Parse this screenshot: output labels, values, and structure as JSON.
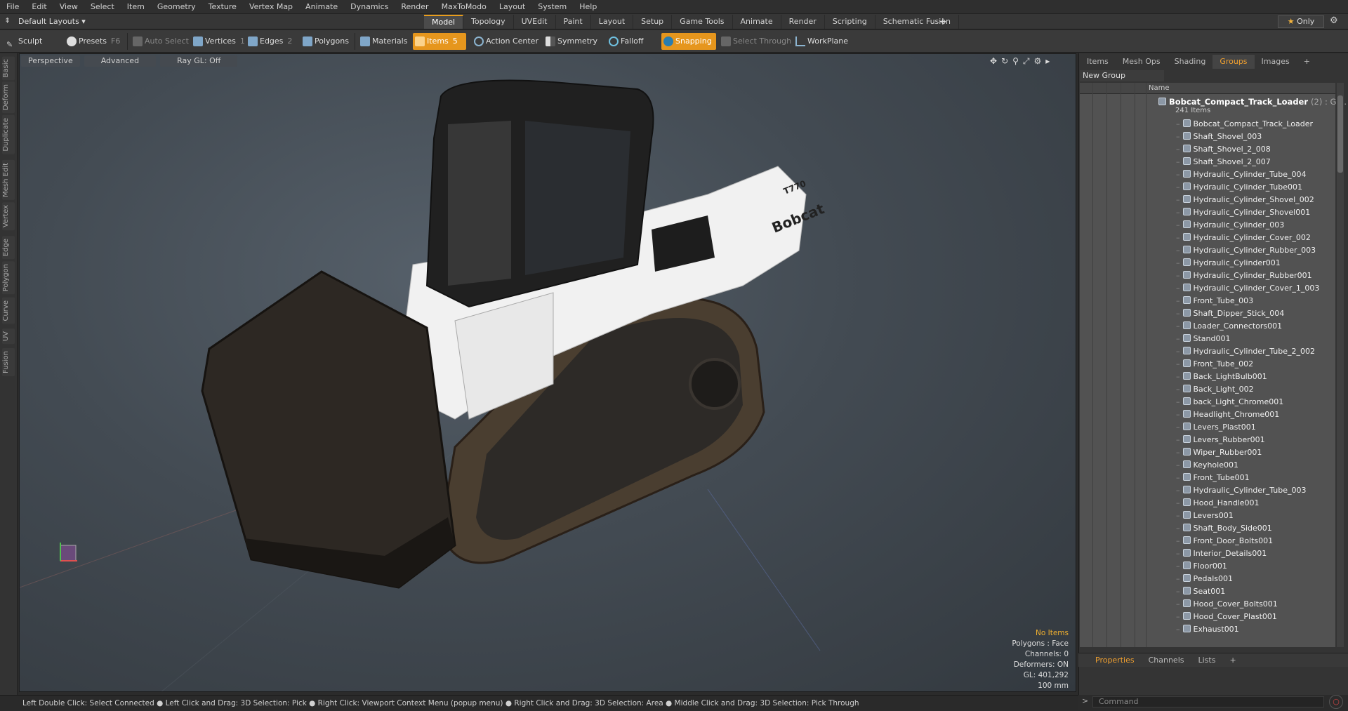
{
  "menu": [
    "File",
    "Edit",
    "View",
    "Select",
    "Item",
    "Geometry",
    "Texture",
    "Vertex Map",
    "Animate",
    "Dynamics",
    "Render",
    "MaxToModo",
    "Layout",
    "System",
    "Help"
  ],
  "layout_dropdown": "Default Layouts ▾",
  "mode_tabs": [
    "Model",
    "Topology",
    "UVEdit",
    "Paint",
    "Layout",
    "Setup",
    "Game Tools",
    "Animate",
    "Render",
    "Scripting",
    "Schematic Fusion"
  ],
  "mode_tab_plus": "+",
  "only_label": "Only",
  "toolbar": {
    "sculpt": "Sculpt",
    "presets": "Presets",
    "presets_key": "F6",
    "auto_select": "Auto Select",
    "vertices": "Vertices",
    "vertices_count": "1",
    "edges": "Edges",
    "edges_count": "2",
    "polygons": "Polygons",
    "materials": "Materials",
    "items": "Items",
    "items_count": "5",
    "action_center": "Action Center",
    "symmetry": "Symmetry",
    "falloff": "Falloff",
    "snapping": "Snapping",
    "select_through": "Select Through",
    "workplane": "WorkPlane"
  },
  "left_tabs": [
    "Basic",
    "Deform",
    "Duplicate",
    "Mesh Edit",
    "Vertex",
    "Edge",
    "Polygon",
    "Curve",
    "UV",
    "Fusion"
  ],
  "viewport": {
    "perspective": "Perspective",
    "advanced": "Advanced",
    "raygl": "Ray GL: Off",
    "stats": {
      "no_items": "No Items",
      "polygons": "Polygons : Face",
      "channels": "Channels: 0",
      "deformers": "Deformers: ON",
      "gl": "GL: 401,292",
      "scale": "100 mm"
    },
    "decal_logo": "Bobcat",
    "decal_model": "T770"
  },
  "status": "Left Double Click: Select Connected ● Left Click and Drag: 3D Selection: Pick ● Right Click: Viewport Context Menu (popup menu) ● Right Click and Drag: 3D Selection: Area ● Middle Click and Drag: 3D Selection: Pick Through",
  "right_tabs": [
    "Items",
    "Mesh Ops",
    "Shading",
    "Groups",
    "Images",
    "+"
  ],
  "right_active_tab": "Groups",
  "new_group": "New Group",
  "name_header": "Name",
  "group": {
    "name": "Bobcat_Compact_Track_Loader",
    "suffix": "(2) : Gr...",
    "count": "241 Items"
  },
  "items": [
    "Bobcat_Compact_Track_Loader",
    "Shaft_Shovel_003",
    "Shaft_Shovel_2_008",
    "Shaft_Shovel_2_007",
    "Hydraulic_Cylinder_Tube_004",
    "Hydraulic_Cylinder_Tube001",
    "Hydraulic_Cylinder_Shovel_002",
    "Hydraulic_Cylinder_Shovel001",
    "Hydraulic_Cylinder_003",
    "Hydraulic_Cylinder_Cover_002",
    "Hydraulic_Cylinder_Rubber_003",
    "Hydraulic_Cylinder001",
    "Hydraulic_Cylinder_Rubber001",
    "Hydraulic_Cylinder_Cover_1_003",
    "Front_Tube_003",
    "Shaft_Dipper_Stick_004",
    "Loader_Connectors001",
    "Stand001",
    "Hydraulic_Cylinder_Tube_2_002",
    "Front_Tube_002",
    "Back_LightBulb001",
    "Back_Light_002",
    "back_Light_Chrome001",
    "Headlight_Chrome001",
    "Levers_Plast001",
    "Levers_Rubber001",
    "Wiper_Rubber001",
    "Keyhole001",
    "Front_Tube001",
    "Hydraulic_Cylinder_Tube_003",
    "Hood_Handle001",
    "Levers001",
    "Shaft_Body_Side001",
    "Front_Door_Bolts001",
    "Interior_Details001",
    "Floor001",
    "Pedals001",
    "Seat001",
    "Hood_Cover_Bolts001",
    "Hood_Cover_Plast001",
    "Exhaust001"
  ],
  "bottom_tabs": [
    "Properties",
    "Channels",
    "Lists",
    "+"
  ],
  "command_placeholder": "Command",
  "colors": {
    "accent": "#e6961d",
    "active_tab_text": "#f0a030"
  }
}
